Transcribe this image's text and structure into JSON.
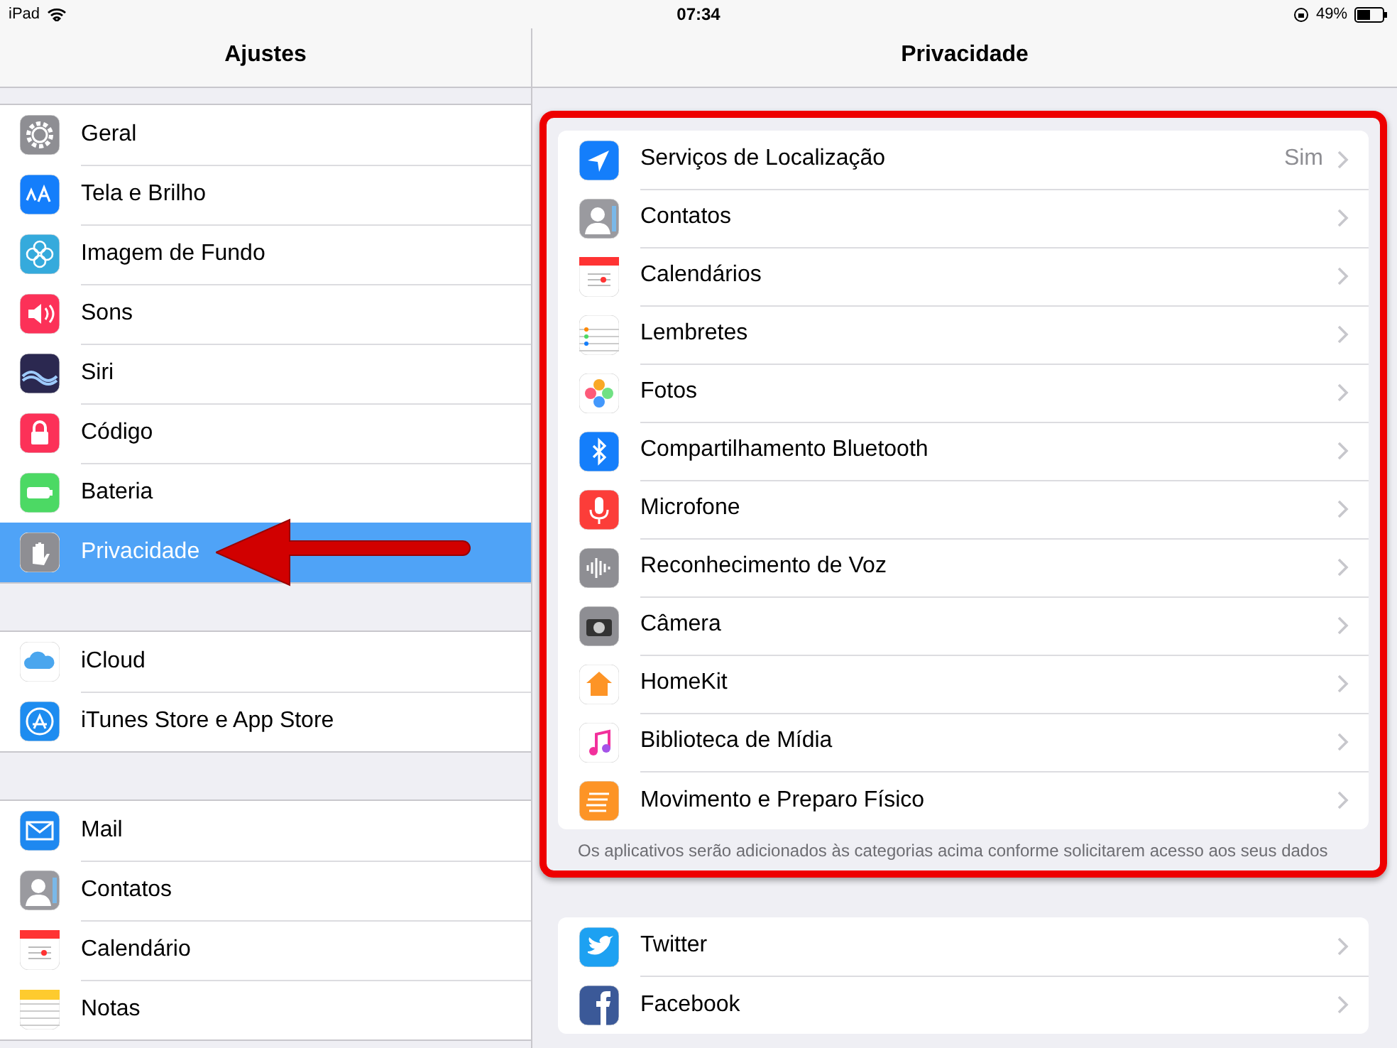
{
  "status_bar": {
    "device": "iPad",
    "time": "07:34",
    "battery": "49%"
  },
  "sidebar": {
    "title": "Ajustes",
    "arrow_at_selected": true,
    "groups": [
      {
        "items": [
          {
            "label": "Geral",
            "selected": false
          },
          {
            "label": "Tela e Brilho",
            "selected": false
          },
          {
            "label": "Imagem de Fundo",
            "selected": false
          },
          {
            "label": "Sons",
            "selected": false
          },
          {
            "label": "Siri",
            "selected": false
          },
          {
            "label": "Código",
            "selected": false
          },
          {
            "label": "Bateria",
            "selected": false
          },
          {
            "label": "Privacidade",
            "selected": true
          }
        ]
      },
      {
        "items": [
          {
            "label": "iCloud",
            "selected": false
          },
          {
            "label": "iTunes Store e App Store",
            "selected": false
          }
        ]
      },
      {
        "items": [
          {
            "label": "Mail",
            "selected": false
          },
          {
            "label": "Contatos",
            "selected": false
          },
          {
            "label": "Calendário",
            "selected": false
          },
          {
            "label": "Notas",
            "selected": false
          }
        ]
      }
    ]
  },
  "detail": {
    "title": "Privacidade",
    "sections": [
      {
        "highlighted": true,
        "items": [
          {
            "label": "Serviços de Localização",
            "value": "Sim"
          },
          {
            "label": "Contatos"
          },
          {
            "label": "Calendários"
          },
          {
            "label": "Lembretes"
          },
          {
            "label": "Fotos"
          },
          {
            "label": "Compartilhamento Bluetooth"
          },
          {
            "label": "Microfone"
          },
          {
            "label": "Reconhecimento de Voz"
          },
          {
            "label": "Câmera"
          },
          {
            "label": "HomeKit"
          },
          {
            "label": "Biblioteca de Mídia"
          },
          {
            "label": "Movimento e Preparo Físico"
          }
        ],
        "footer": "Os aplicativos serão adicionados às categorias acima conforme solicitarem acesso aos seus dados"
      },
      {
        "highlighted": false,
        "items": [
          {
            "label": "Twitter"
          },
          {
            "label": "Facebook"
          }
        ]
      }
    ]
  }
}
